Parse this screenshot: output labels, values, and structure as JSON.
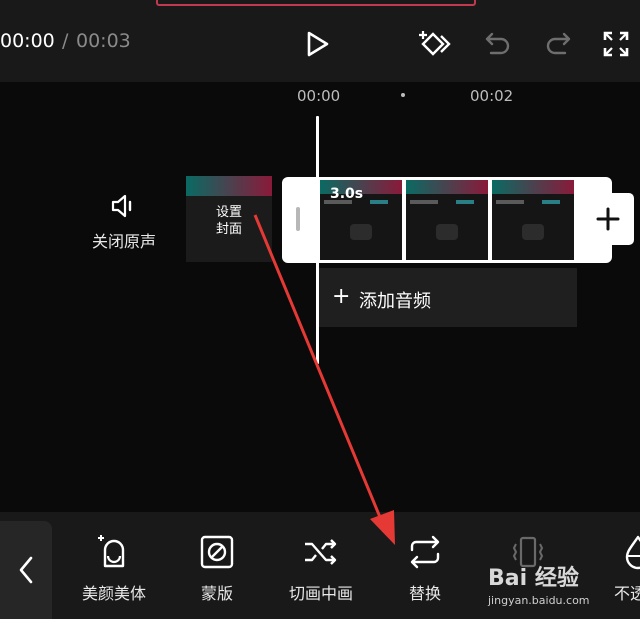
{
  "header": {
    "current_time": "00:00",
    "separator": "/",
    "total_time": "00:03",
    "icons": [
      "play-icon",
      "keyframe-icon",
      "undo-icon",
      "redo-icon",
      "fullscreen-icon"
    ]
  },
  "ruler": {
    "ticks": [
      "00:00",
      "00:02"
    ]
  },
  "timeline": {
    "mute_label": "关闭原声",
    "cover_label": "设置\n封面",
    "clip_duration": "3.0s",
    "add_audio_label": "添加音频"
  },
  "toolbar": {
    "items": [
      {
        "label": "美颜美体",
        "icon": "beauty-icon"
      },
      {
        "label": "蒙版",
        "icon": "mask-icon"
      },
      {
        "label": "切画中画",
        "icon": "shuffle-icon"
      },
      {
        "label": "替换",
        "icon": "replace-icon"
      },
      {
        "label": "",
        "icon": "vibrate-icon"
      },
      {
        "label": "不透明",
        "icon": "opacity-icon"
      }
    ]
  },
  "watermark": {
    "logo": "Bai 经验",
    "site": "jingyan.baidu.com"
  },
  "colors": {
    "accent": "#c0394f",
    "arrow": "#e53935",
    "background": "#0a0a0a",
    "panel": "#191919"
  }
}
